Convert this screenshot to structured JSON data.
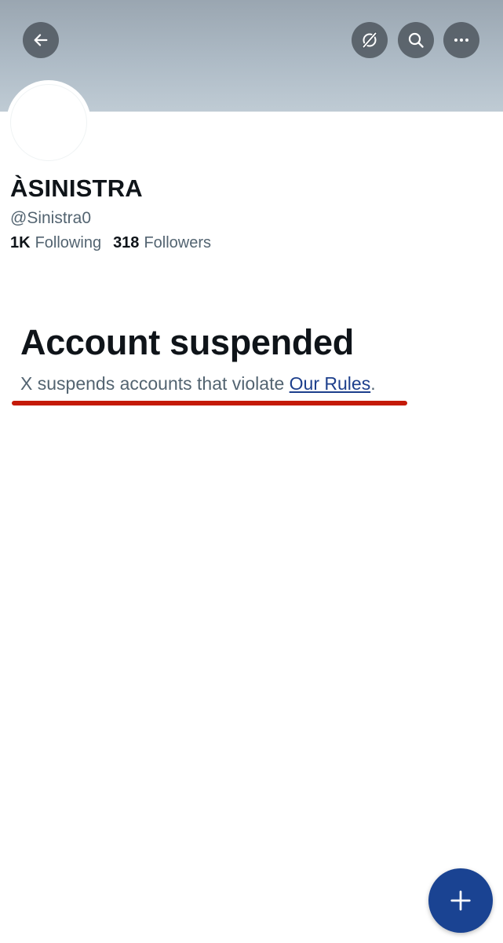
{
  "header": {
    "back_icon": "arrow-left-icon",
    "grok_icon": "grok-icon",
    "search_icon": "search-icon",
    "more_icon": "more-horizontal-icon"
  },
  "profile": {
    "display_name": "ÀSINISTRA",
    "handle": "@Sinistra0",
    "following_count": "1K",
    "following_label": "Following",
    "followers_count": "318",
    "followers_label": "Followers"
  },
  "suspension": {
    "title": "Account suspended",
    "message_prefix": "X suspends accounts that violate ",
    "rules_link": "Our Rules",
    "message_suffix": ".",
    "annotation_color": "#c41a08"
  },
  "fab": {
    "icon": "plus-icon",
    "color": "#1a4392"
  }
}
